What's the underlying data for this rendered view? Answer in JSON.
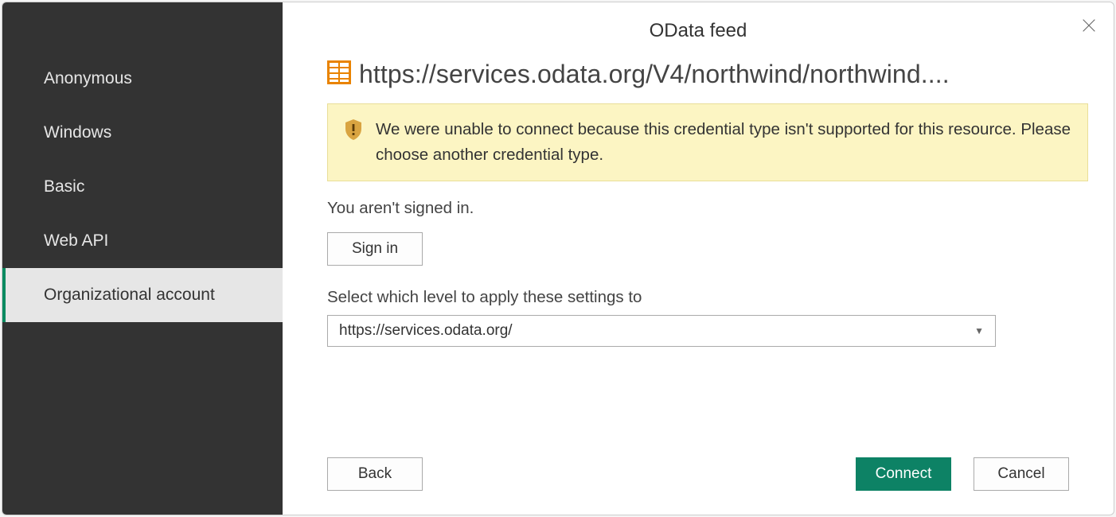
{
  "dialog": {
    "title": "OData feed"
  },
  "sidebar": {
    "items": [
      {
        "label": "Anonymous",
        "selected": false
      },
      {
        "label": "Windows",
        "selected": false
      },
      {
        "label": "Basic",
        "selected": false
      },
      {
        "label": "Web API",
        "selected": false
      },
      {
        "label": "Organizational account",
        "selected": true
      }
    ]
  },
  "main": {
    "url": "https://services.odata.org/V4/northwind/northwind....",
    "warning_message": "We were unable to connect because this credential type isn't supported for this resource. Please choose another credential type.",
    "signin_status": "You aren't signed in.",
    "signin_button": "Sign in",
    "level_label": "Select which level to apply these settings to",
    "level_selected": "https://services.odata.org/"
  },
  "footer": {
    "back": "Back",
    "connect": "Connect",
    "cancel": "Cancel"
  },
  "colors": {
    "accent": "#0d8265",
    "sidebar_bg": "#333333",
    "warning_bg": "#fcf5c3"
  }
}
